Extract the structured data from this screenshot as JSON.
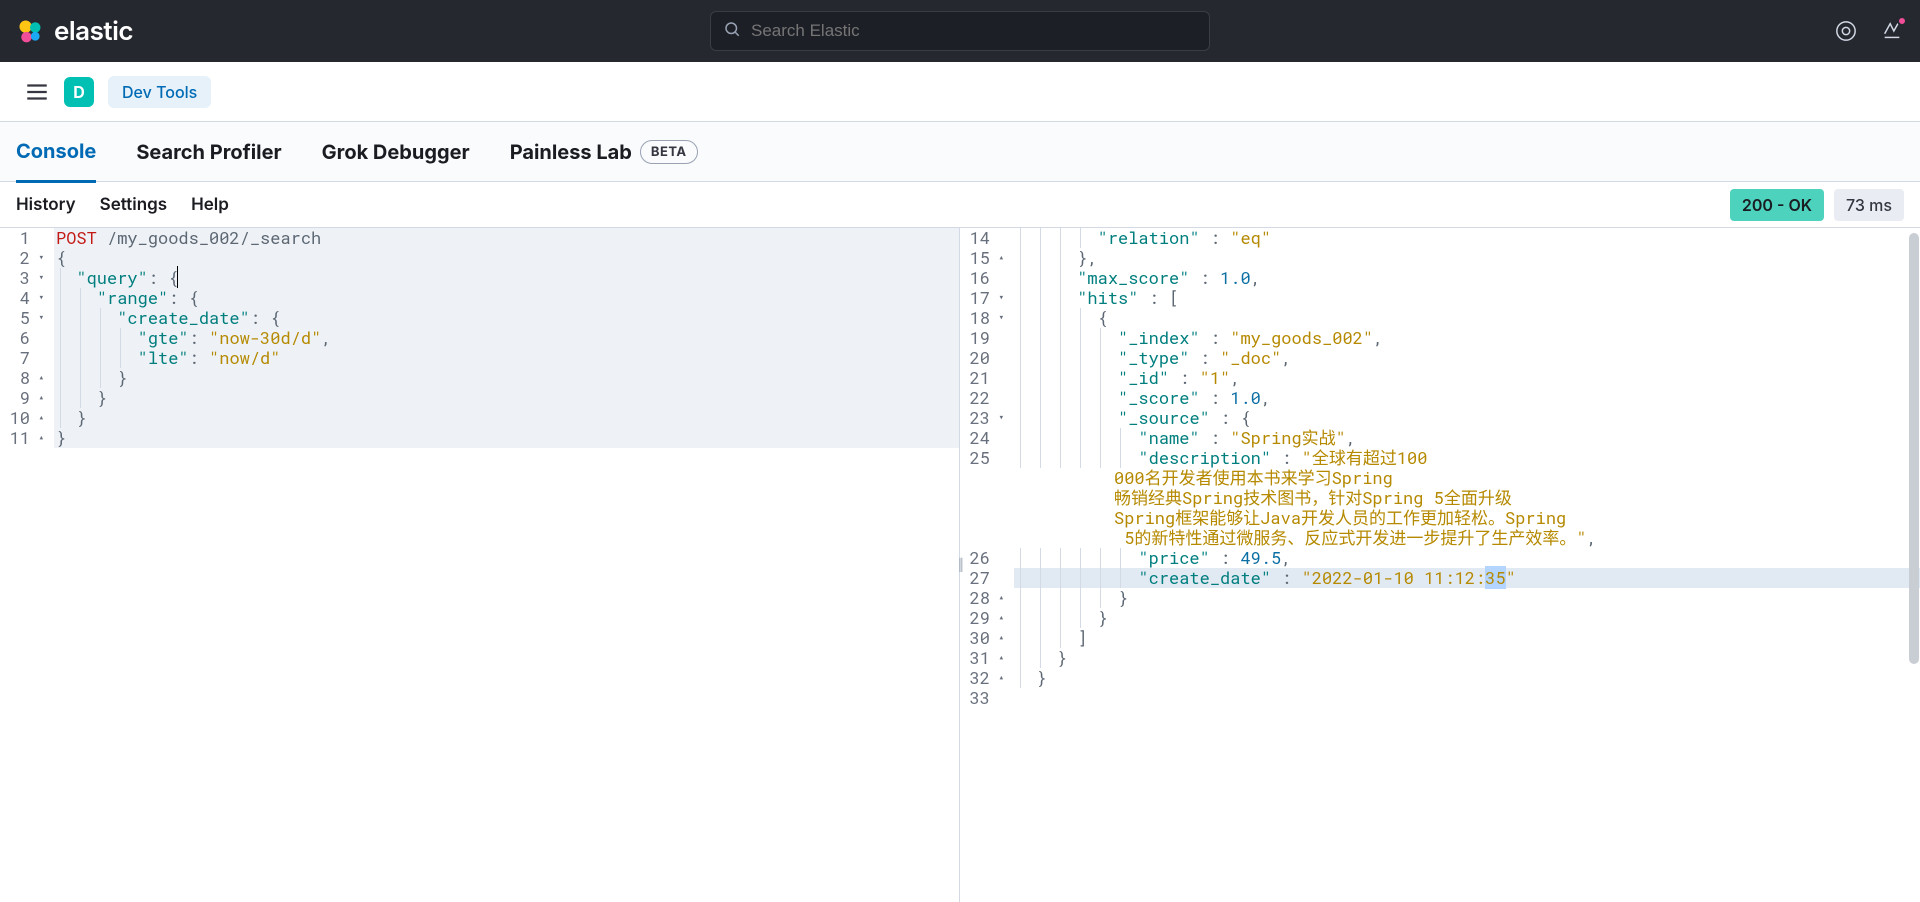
{
  "brand": "elastic",
  "search_placeholder": "Search Elastic",
  "space_badge": "D",
  "breadcrumb": "Dev Tools",
  "tabs": [
    "Console",
    "Search Profiler",
    "Grok Debugger",
    "Painless Lab"
  ],
  "beta_label": "BETA",
  "active_tab_index": 0,
  "tool_links": [
    "History",
    "Settings",
    "Help"
  ],
  "status": "200 - OK",
  "elapsed": "73 ms",
  "request": {
    "method": "POST",
    "path": "/my_goods_002/_search",
    "body_lines": [
      {
        "n": 1,
        "fold": "",
        "kind": "req"
      },
      {
        "n": 2,
        "fold": "▾",
        "text": "{"
      },
      {
        "n": 3,
        "fold": "▾",
        "indent": 1,
        "key": "query",
        "open": "{",
        "active": true,
        "cursor": true
      },
      {
        "n": 4,
        "fold": "▾",
        "indent": 2,
        "key": "range",
        "open": "{"
      },
      {
        "n": 5,
        "fold": "▾",
        "indent": 3,
        "key": "create_date",
        "open": "{"
      },
      {
        "n": 6,
        "fold": "",
        "indent": 4,
        "key": "gte",
        "val": "now-30d/d",
        "comma": true
      },
      {
        "n": 7,
        "fold": "",
        "indent": 4,
        "key": "lte",
        "val": "now/d"
      },
      {
        "n": 8,
        "fold": "▴",
        "indent": 3,
        "close": "}"
      },
      {
        "n": 9,
        "fold": "▴",
        "indent": 2,
        "close": "}"
      },
      {
        "n": 10,
        "fold": "▴",
        "indent": 1,
        "close": "}"
      },
      {
        "n": 11,
        "fold": "▴",
        "indent": 0,
        "close": "}"
      }
    ]
  },
  "response_lines": [
    {
      "n": 14,
      "indent": 4,
      "key": "relation",
      "str": "eq"
    },
    {
      "n": 15,
      "fold": "▴",
      "indent": 3,
      "close": "},"
    },
    {
      "n": 16,
      "indent": 3,
      "key": "max_score",
      "num": "1.0",
      "comma": true
    },
    {
      "n": 17,
      "fold": "▾",
      "indent": 3,
      "key": "hits",
      "openarr": "["
    },
    {
      "n": 18,
      "fold": "▾",
      "indent": 4,
      "open": "{"
    },
    {
      "n": 19,
      "indent": 5,
      "key": "_index",
      "str": "my_goods_002",
      "comma": true
    },
    {
      "n": 20,
      "indent": 5,
      "key": "_type",
      "str": "_doc",
      "comma": true
    },
    {
      "n": 21,
      "indent": 5,
      "key": "_id",
      "str": "1",
      "comma": true
    },
    {
      "n": 22,
      "indent": 5,
      "key": "_score",
      "num": "1.0",
      "comma": true
    },
    {
      "n": 23,
      "fold": "▾",
      "indent": 5,
      "key": "_source",
      "open": "{"
    },
    {
      "n": 24,
      "indent": 6,
      "key": "name",
      "str": "Spring实战",
      "comma": true
    },
    {
      "n": 25,
      "indent": 6,
      "key": "description",
      "str_start": "全球有超过100",
      "wrap": [
        "000名开发者使用本书来学习Spring",
        "畅销经典Spring技术图书，针对Spring 5全面升级",
        "Spring框架能够让Java开发人员的工作更加轻松。Spring",
        " 5的新特性通过微服务、反应式开发进一步提升了生产效率。"
      ],
      "end_comma": true
    },
    {
      "n": 26,
      "indent": 6,
      "key": "price",
      "num": "49.5",
      "comma": true
    },
    {
      "n": 27,
      "indent": 6,
      "key": "create_date",
      "str": "2022-01-10 11:12:35",
      "highlight": true,
      "sel": [
        17,
        19
      ]
    },
    {
      "n": 28,
      "fold": "▴",
      "indent": 5,
      "close": "}"
    },
    {
      "n": 29,
      "fold": "▴",
      "indent": 4,
      "close": "}"
    },
    {
      "n": 30,
      "fold": "▴",
      "indent": 3,
      "close": "]"
    },
    {
      "n": 31,
      "fold": "▴",
      "indent": 2,
      "close": "}"
    },
    {
      "n": 32,
      "fold": "▴",
      "indent": 1,
      "close": "}"
    },
    {
      "n": 33,
      "indent": 0,
      "blank": true
    }
  ]
}
